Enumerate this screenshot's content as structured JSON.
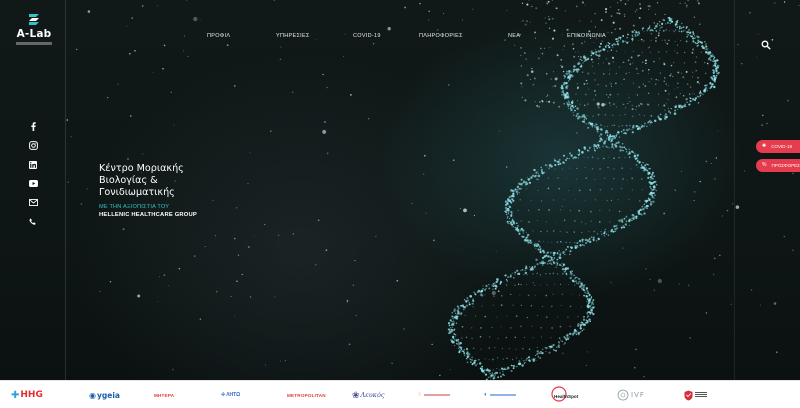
{
  "brand": {
    "logo_text": "A-Lab"
  },
  "nav": {
    "items": [
      {
        "label": "ΠΡΟΦΙΛ"
      },
      {
        "label": "ΥΠΗΡΕΣΙΕΣ"
      },
      {
        "label": "COVID-19"
      },
      {
        "label": "ΠΛΗΡΟΦΟΡΙΕΣ"
      },
      {
        "label": "ΝΕΑ"
      },
      {
        "label": "ΕΠΙΚΟΙΝΩΝΙΑ"
      }
    ],
    "search_icon": "search-icon"
  },
  "social": [
    "facebook-icon",
    "instagram-icon",
    "linkedin-icon",
    "youtube-icon",
    "email-icon",
    "phone-icon"
  ],
  "hero": {
    "title_line1": "Κέντρο Μοριακής",
    "title_line2": "Βιολογίας &",
    "title_line3": "Γονιδιωματικής",
    "tagline": "ΜΕ ΤΗΝ ΑΞΙΟΠΙΣΤΙΑ ΤΟΥ",
    "group": "HELLENIC HEALTHCARE GROUP"
  },
  "quick_links": [
    {
      "label": "COVID-19"
    },
    {
      "label": "ΠΡΟΣΦΟΡΕΣ"
    }
  ],
  "partners": [
    {
      "label": "HHG"
    },
    {
      "label": "ygeia"
    },
    {
      "label": "ΜΗΤΕΡΑ"
    },
    {
      "label": "ΛΗΤΩ"
    },
    {
      "label": "METROPOLITAN"
    },
    {
      "label": "Λευκός"
    },
    {
      "label": "HealthSpot"
    },
    {
      "label": "IVF"
    }
  ],
  "colors": {
    "accent_teal": "#35c2c8",
    "pill_red": "#e53c4e",
    "background": "#0d1413"
  }
}
